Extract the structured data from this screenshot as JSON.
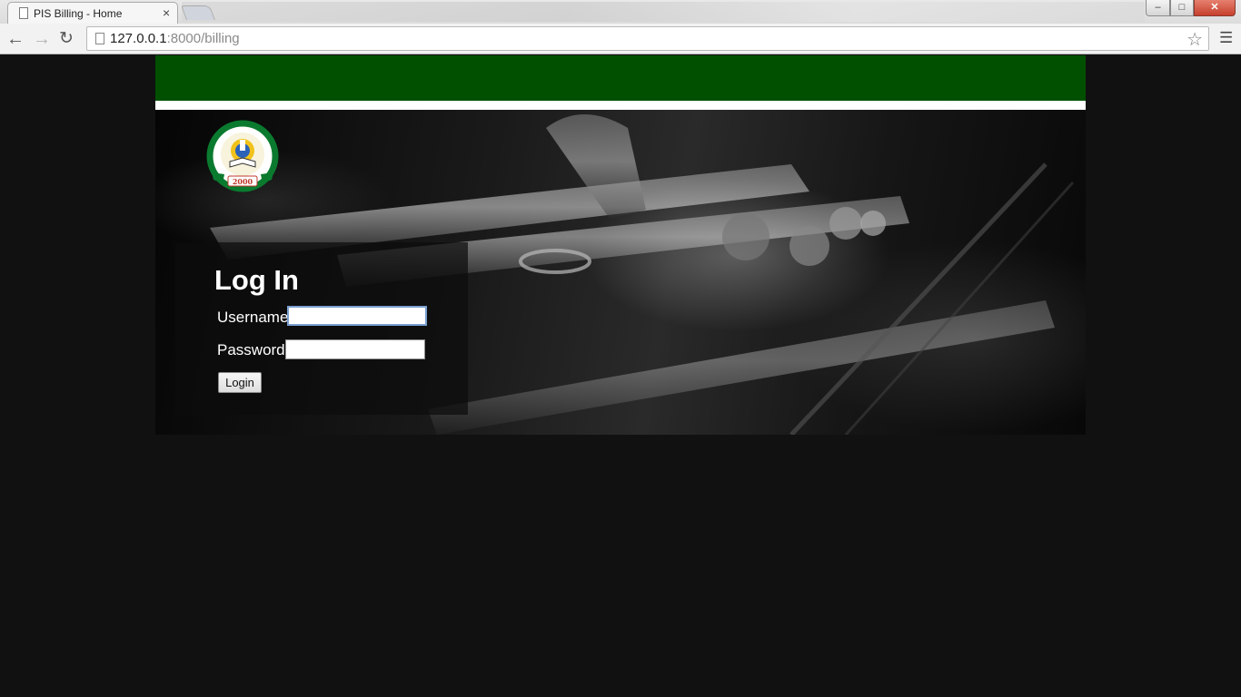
{
  "browser": {
    "tab_title": "PIS Billing - Home",
    "tab_close": "×",
    "url_host": "127.0.0.1",
    "url_path": ":8000/billing",
    "window_buttons": {
      "minimize": "–",
      "maximize": "□",
      "close": "✕"
    },
    "icons": {
      "back": "back-arrow-icon",
      "forward": "forward-arrow-icon",
      "reload": "reload-icon",
      "bookmark": "star-icon",
      "menu": "hamburger-menu-icon"
    }
  },
  "page": {
    "colors": {
      "banner": "#005000",
      "background": "#111111",
      "stripe": "#ffffff"
    },
    "logo": {
      "year": "2000"
    },
    "login": {
      "title": "Log In",
      "username_label": "Username",
      "password_label": "Password",
      "username_value": "",
      "password_value": "",
      "submit_label": "Login"
    }
  }
}
